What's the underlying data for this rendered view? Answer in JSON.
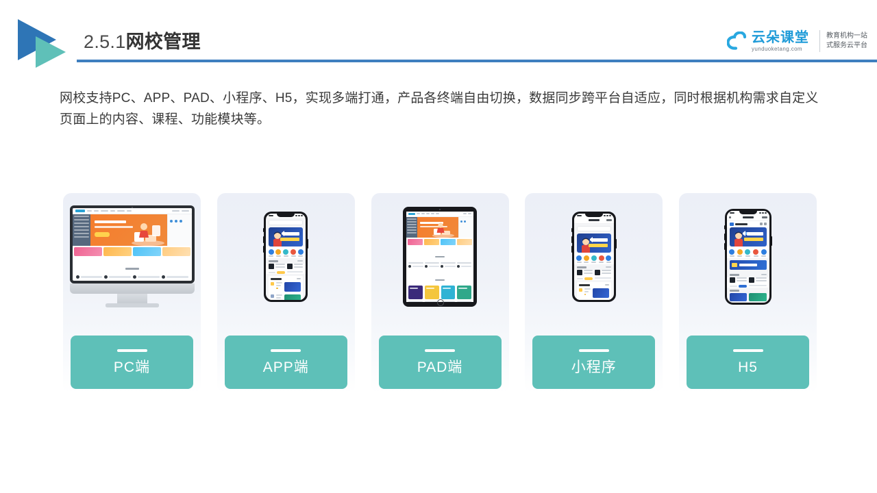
{
  "header": {
    "title_number": "2.5.1",
    "title_name": "网校管理",
    "rule_color": "#3f7fbf",
    "logo_triangle_blue": "#2E75B6",
    "logo_triangle_teal": "#5FC0B8"
  },
  "brand": {
    "name_cn": "云朵课堂",
    "domain": "yunduoketang.com",
    "tagline_line1": "教育机构一站",
    "tagline_line2": "式服务云平台",
    "color": "#1f9bd8"
  },
  "body": {
    "paragraph": "网校支持PC、APP、PAD、小程序、H5，实现多端打通，产品各终端自由切换，数据同步跨平台自适应，同时根据机构需求自定义页面上的内容、课程、功能模块等。"
  },
  "cards": [
    {
      "label": "PC端",
      "device": "desktop-monitor"
    },
    {
      "label": "APP端",
      "device": "smartphone"
    },
    {
      "label": "PAD端",
      "device": "tablet"
    },
    {
      "label": "小程序",
      "device": "smartphone"
    },
    {
      "label": "H5",
      "device": "smartphone"
    }
  ],
  "theme": {
    "pill_color": "#5EC0B8",
    "card_background_top": "#eceff7",
    "card_background_bottom": "#ffffff",
    "page_background": "#ffffff"
  }
}
